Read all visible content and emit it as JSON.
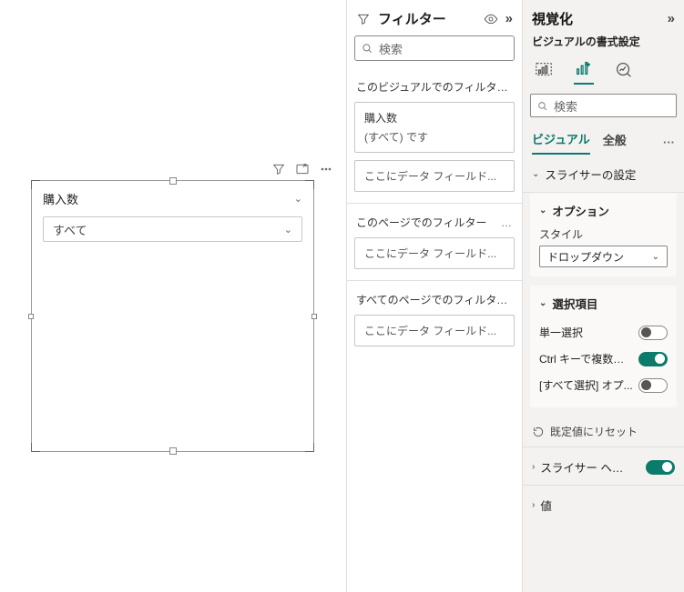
{
  "slicer": {
    "title": "購入数",
    "dropdown_value": "すべて"
  },
  "filters": {
    "title": "フィルター",
    "search_placeholder": "検索",
    "this_visual_label": "このビジュアルでのフィルター…",
    "visual_filter": {
      "field": "購入数",
      "state": "(すべて) です"
    },
    "drop_here": "ここにデータ フィールド...",
    "this_page_label": "このページでのフィルター",
    "all_pages_label": "すべてのページでのフィルター…"
  },
  "format": {
    "title": "視覚化",
    "subtitle": "ビジュアルの書式設定",
    "search_placeholder": "検索",
    "tab_visual": "ビジュアル",
    "tab_general": "全般",
    "slicer_settings_label": "スライサーの設定",
    "options_label": "オプション",
    "style_label": "スタイル",
    "style_value": "ドロップダウン",
    "selection_label": "選択項目",
    "single_select_label": "単一選択",
    "multi_ctrl_label": "Ctrl キーで複数選択",
    "select_all_label": "[すべて選択] オプ...",
    "reset_label": "既定値にリセット",
    "slicer_header_label": "スライサー ヘッ...",
    "value_label": "値"
  }
}
